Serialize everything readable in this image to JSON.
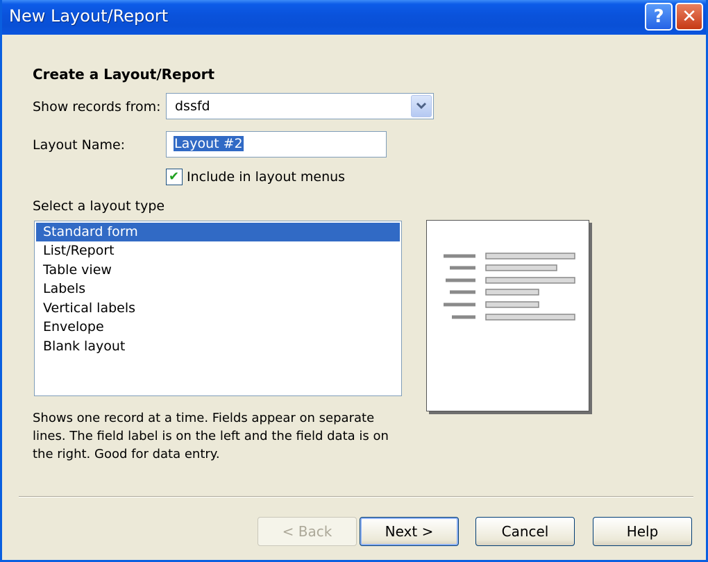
{
  "window": {
    "title": "New Layout/Report"
  },
  "titlebar": {
    "help_glyph": "?",
    "close_glyph": "✕"
  },
  "form": {
    "heading": "Create a Layout/Report",
    "show_records_label": "Show records from:",
    "show_records_value": "dssfd",
    "layout_name_label": "Layout Name:",
    "layout_name_value": "Layout #2",
    "include_menus_label": "Include in layout menus",
    "include_menus_checked": true,
    "layout_type_label": "Select a layout type",
    "layout_types": [
      "Standard form",
      "List/Report",
      "Table view",
      "Labels",
      "Vertical labels",
      "Envelope",
      "Blank layout"
    ],
    "selected_layout_type": "Standard form",
    "description": "Shows one record at a time. Fields appear on separate lines.  The field label is on the left and the field data is on the right.  Good for data entry."
  },
  "buttons": {
    "back": "< Back",
    "next": "Next >",
    "cancel": "Cancel",
    "help": "Help"
  },
  "colors": {
    "titlebar": "#0a52db",
    "selection": "#316ac5",
    "dialog_bg": "#ece9d8"
  }
}
